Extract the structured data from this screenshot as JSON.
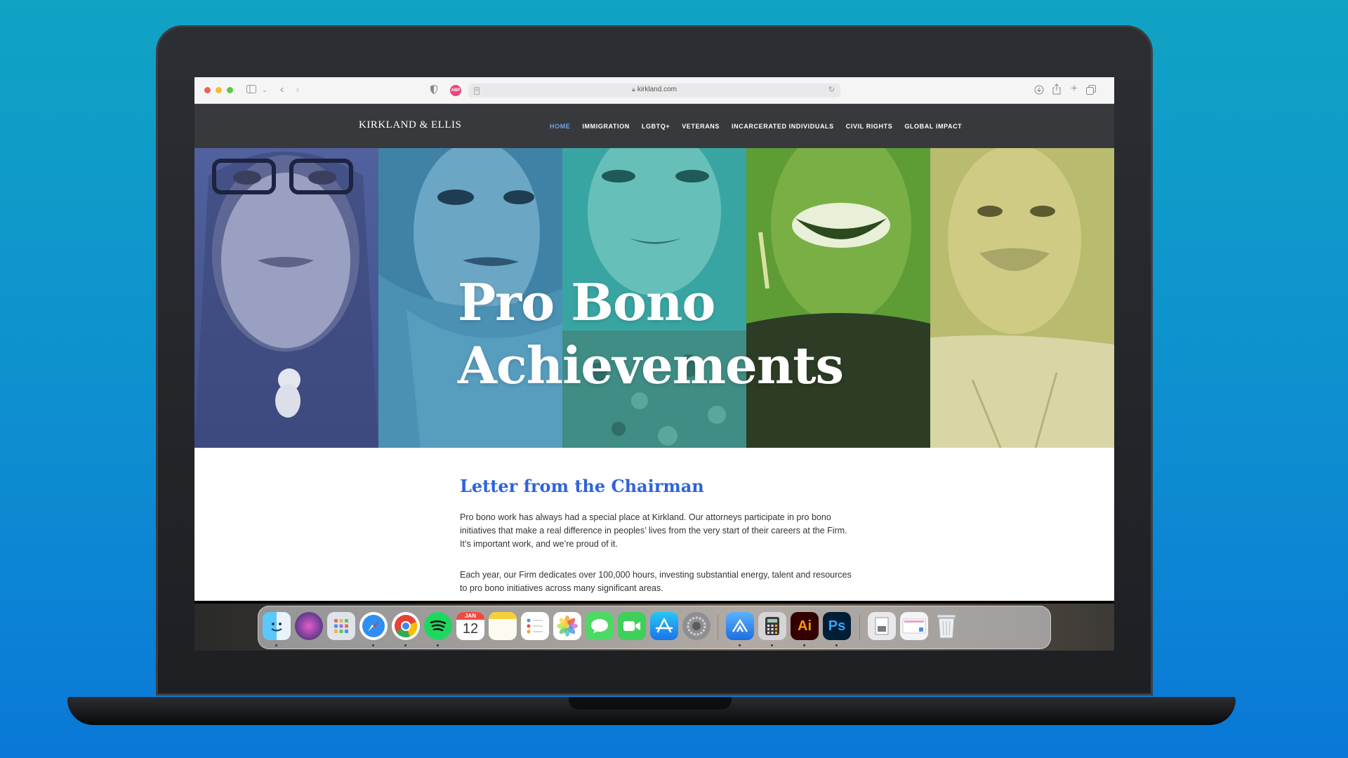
{
  "browser": {
    "url": "kirkland.com",
    "abp_label": "ABP"
  },
  "site": {
    "logo": "KIRKLAND & ELLIS",
    "nav": [
      {
        "label": "HOME",
        "active": true
      },
      {
        "label": "IMMIGRATION",
        "active": false
      },
      {
        "label": "LGBTQ+",
        "active": false
      },
      {
        "label": "VETERANS",
        "active": false
      },
      {
        "label": "INCARCERATED INDIVIDUALS",
        "active": false
      },
      {
        "label": "CIVIL RIGHTS",
        "active": false
      },
      {
        "label": "GLOBAL IMPACT",
        "active": false
      }
    ],
    "hero": {
      "line1": "Pro Bono",
      "line2": "Achievements",
      "panel_colors": [
        "#4b5e9a",
        "#3f86a8",
        "#3aa3a4",
        "#5e9e3e",
        "#b7b66a"
      ]
    },
    "letter": {
      "title": "Letter from the Chairman",
      "p1": "Pro bono work has always had a special place at Kirkland. Our attorneys participate in pro bono initiatives that make a real difference in peoples’ lives from the very start of their careers at the Firm. It’s important work, and we’re proud of it.",
      "p2": "Each year, our Firm dedicates over 100,000 hours, investing substantial energy, talent and resources to pro bono initiatives across many significant areas."
    }
  },
  "dock": {
    "calendar_month": "JAN",
    "calendar_day": "12",
    "illustrator_label": "Ai",
    "photoshop_label": "Ps"
  }
}
